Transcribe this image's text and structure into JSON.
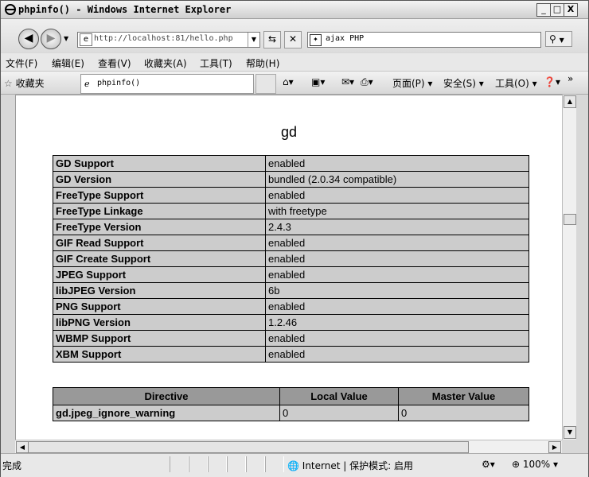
{
  "window": {
    "title": "phpinfo() - Windows Internet Explorer",
    "minimize": "_",
    "maximize": "□",
    "close": "X"
  },
  "address": {
    "url": "http://localhost:81/hello.php",
    "search_value": "ajax PHP"
  },
  "menu": [
    "文件(F)",
    "编辑(E)",
    "查看(V)",
    "收藏夹(A)",
    "工具(T)",
    "帮助(H)"
  ],
  "favorites_bar": {
    "favorites_label": "收藏夹",
    "tab_title": "phpinfo()",
    "page_menu": "页面(P)",
    "safety_menu": "安全(S)",
    "tools_menu": "工具(O)",
    "overflow": "»"
  },
  "content": {
    "heading": "gd",
    "gd_rows": [
      {
        "key": "GD Support",
        "value": "enabled"
      },
      {
        "key": "GD Version",
        "value": "bundled (2.0.34 compatible)"
      },
      {
        "key": "FreeType Support",
        "value": "enabled"
      },
      {
        "key": "FreeType Linkage",
        "value": "with freetype"
      },
      {
        "key": "FreeType Version",
        "value": "2.4.3"
      },
      {
        "key": "GIF Read Support",
        "value": "enabled"
      },
      {
        "key": "GIF Create Support",
        "value": "enabled"
      },
      {
        "key": "JPEG Support",
        "value": "enabled"
      },
      {
        "key": "libJPEG Version",
        "value": "6b"
      },
      {
        "key": "PNG Support",
        "value": "enabled"
      },
      {
        "key": "libPNG Version",
        "value": "1.2.46"
      },
      {
        "key": "WBMP Support",
        "value": "enabled"
      },
      {
        "key": "XBM Support",
        "value": "enabled"
      }
    ],
    "directive_headers": [
      "Directive",
      "Local Value",
      "Master Value"
    ],
    "directive_rows": [
      {
        "directive": "gd.jpeg_ignore_warning",
        "local": "0",
        "master": "0"
      }
    ]
  },
  "status": {
    "text": "完成",
    "zone": "Internet | 保护模式: 启用",
    "zoom": "100%"
  }
}
